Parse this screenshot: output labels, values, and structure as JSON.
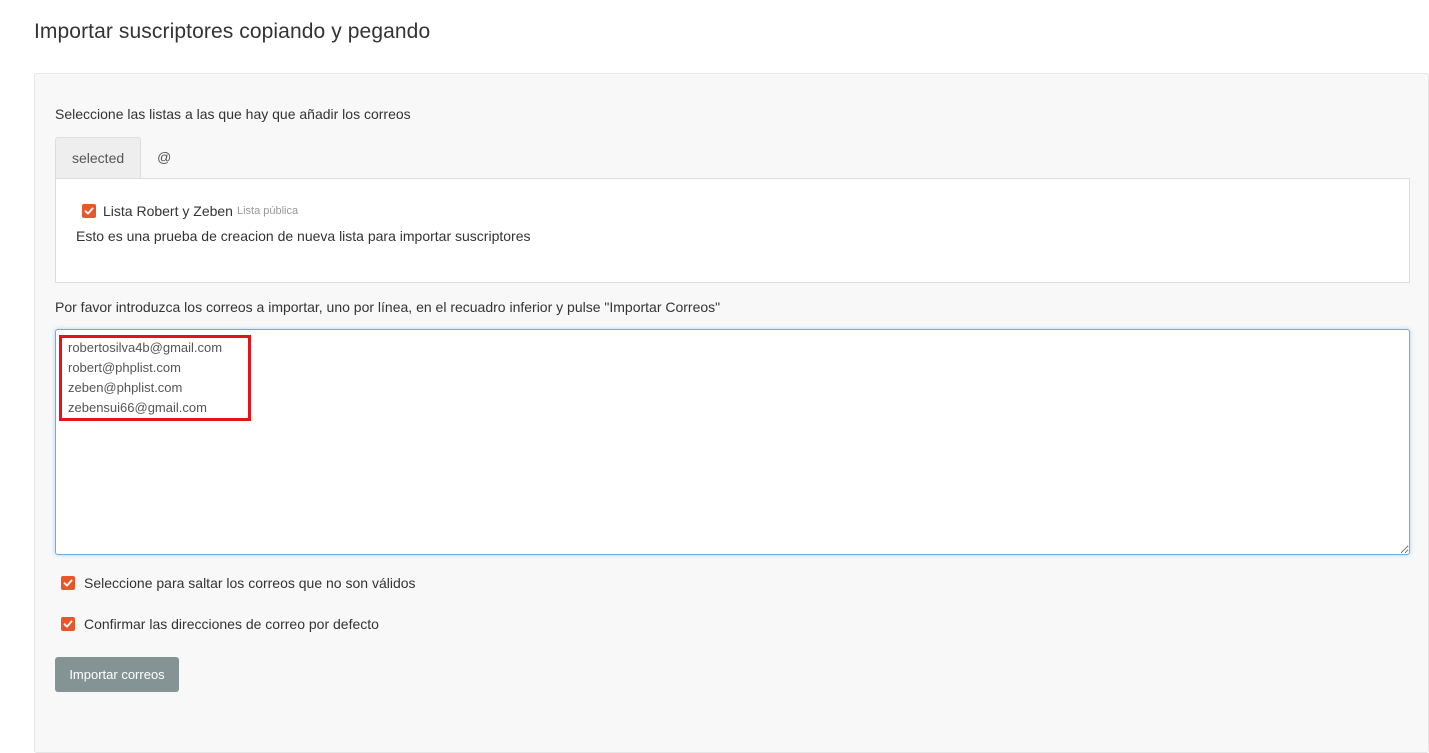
{
  "page": {
    "title": "Importar suscriptores copiando y pegando"
  },
  "lists_section": {
    "instruction": "Seleccione las listas a las que hay que añadir los correos",
    "tabs": [
      {
        "label": "selected",
        "active": true
      },
      {
        "label": "@",
        "active": false
      }
    ],
    "list": {
      "checked": true,
      "name": "Lista Robert y Zeben",
      "badge": "Lista pública",
      "description": "Esto es una prueba de creacion de nueva lista para importar suscriptores"
    }
  },
  "emails_section": {
    "instruction": "Por favor introduzca los correos a importar, uno por línea, en el recuadro inferior y pulse \"Importar Correos\"",
    "value": "robertosilva4b@gmail.com\nrobert@phplist.com\nzeben@phplist.com\nzebensui66@gmail.com"
  },
  "options": [
    {
      "label": "Seleccione para saltar los correos que no son válidos",
      "checked": true
    },
    {
      "label": "Confirmar las direcciones de correo por defecto",
      "checked": true
    }
  ],
  "submit": {
    "label": "Importar correos"
  },
  "colors": {
    "accent": "#e8572c",
    "button": "#849494",
    "highlight": "#e0161b"
  }
}
